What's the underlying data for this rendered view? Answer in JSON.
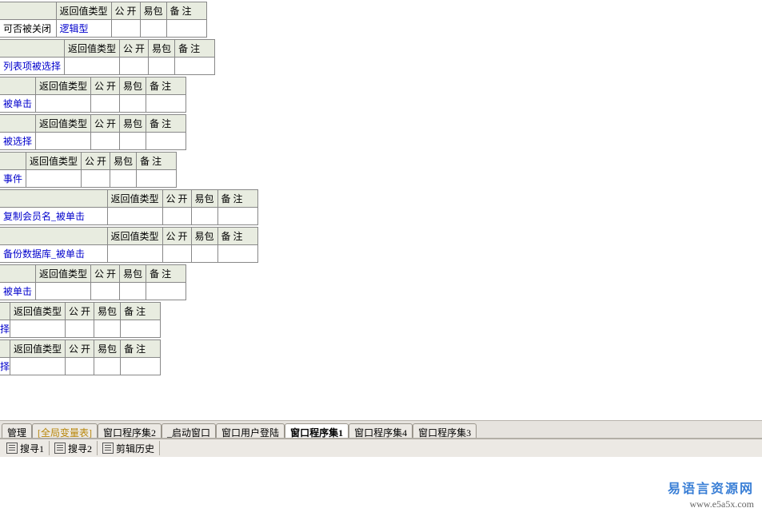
{
  "headers": {
    "return_type": "返回值类型",
    "public": "公 开",
    "easy_pkg": "易包",
    "note": "备 注"
  },
  "rows": [
    {
      "spacer_w": 70,
      "first": "可否被关闭",
      "first_link": false,
      "ret": "逻辑型",
      "ret_link": true
    },
    {
      "spacer_w": 70,
      "first": "列表项被选择",
      "first_link": true
    },
    {
      "spacer_w": 25,
      "first": "被单击",
      "first_link": true
    },
    {
      "spacer_w": 25,
      "first": "被选择",
      "first_link": true
    },
    {
      "spacer_w": 25,
      "first": "事件",
      "first_link": true
    },
    {
      "spacer_w": 134,
      "first": "复制会员名_被单击",
      "first_link": true
    },
    {
      "spacer_w": 134,
      "first": "备份数据库_被单击",
      "first_link": true
    },
    {
      "spacer_w": 25,
      "first": "被单击",
      "first_link": true
    },
    {
      "spacer_w": 9,
      "first": "择",
      "first_link": true
    },
    {
      "spacer_w": 9,
      "first": "择",
      "first_link": true
    }
  ],
  "tabs": [
    {
      "label": "管理",
      "active": false
    },
    {
      "label": "[全局变量表]",
      "active": false,
      "global": true
    },
    {
      "label": "窗口程序集2",
      "active": false
    },
    {
      "label": "_启动窗口",
      "active": false
    },
    {
      "label": "窗口用户登陆",
      "active": false
    },
    {
      "label": "窗口程序集1",
      "active": true
    },
    {
      "label": "窗口程序集4",
      "active": false
    },
    {
      "label": "窗口程序集3",
      "active": false
    }
  ],
  "toolbar": {
    "search1": "搜寻1",
    "search2": "搜寻2",
    "clip": "剪辑历史"
  },
  "watermark": {
    "line1": "易语言资源网",
    "line2": "www.e5a5x.com"
  }
}
